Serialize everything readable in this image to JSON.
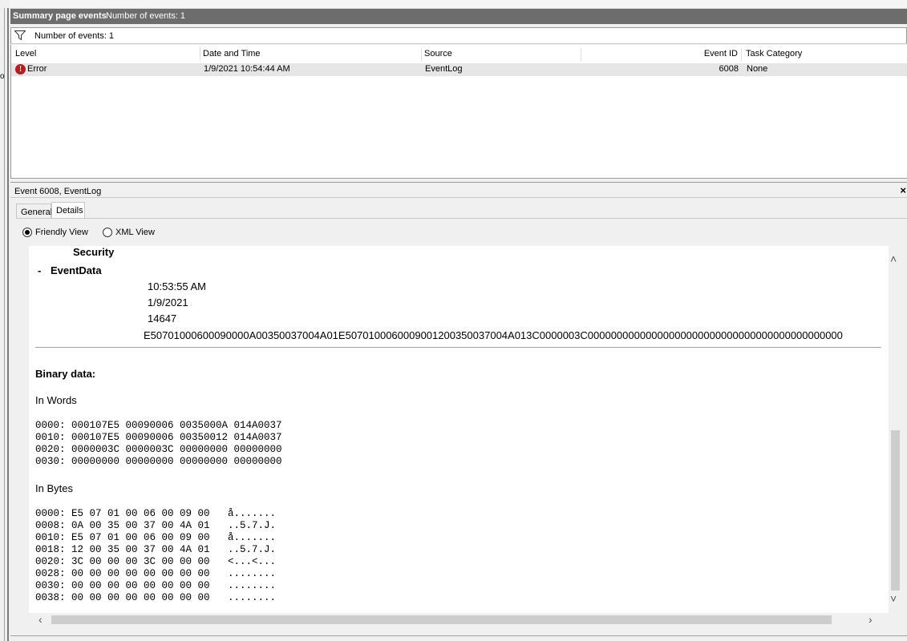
{
  "window": {
    "left_edge_char": "o"
  },
  "summary": {
    "title": "Summary page events",
    "count_label": "Number of events: 1"
  },
  "filter_bar": {
    "text": "Number of events: 1",
    "icon": "funnel-icon"
  },
  "events_table": {
    "columns": [
      "Level",
      "Date and Time",
      "Source",
      "Event ID",
      "Task Category"
    ],
    "rows": [
      {
        "level": "Error",
        "level_icon": "error-icon",
        "date_time": "1/9/2021 10:54:44 AM",
        "source": "EventLog",
        "event_id": "6008",
        "task_category": "None"
      }
    ]
  },
  "detail_pane": {
    "title": "Event 6008, EventLog",
    "close_glyph": "×",
    "tabs": [
      {
        "label": "General",
        "active": false
      },
      {
        "label": "Details",
        "active": true
      }
    ],
    "view_options": [
      {
        "label": "Friendly View",
        "selected": true
      },
      {
        "label": "XML View",
        "selected": false
      }
    ]
  },
  "details": {
    "security_label": "Security",
    "eventdata_toggle": "-",
    "eventdata_label": "EventData",
    "data_values": [
      "10:53:55 AM",
      "1/9/2021",
      "14647",
      "E50701000600090000A00350037004A01E5070100060009001200350037004A013C0000003C00000000000000000000000000000000000000000000"
    ],
    "binary_heading": "Binary data:",
    "in_words_label": "In Words",
    "words_lines": [
      "0000: 000107E5 00090006 0035000A 014A0037",
      "0010: 000107E5 00090006 00350012 014A0037",
      "0020: 0000003C 0000003C 00000000 00000000",
      "0030: 00000000 00000000 00000000 00000000"
    ],
    "in_bytes_label": "In Bytes",
    "bytes_lines": [
      "0000: E5 07 01 00 06 00 09 00   å.......",
      "0008: 0A 00 35 00 37 00 4A 01   ..5.7.J.",
      "0010: E5 07 01 00 06 00 09 00   å.......",
      "0018: 12 00 35 00 37 00 4A 01   ..5.7.J.",
      "0020: 3C 00 00 00 3C 00 00 00   <...<...",
      "0028: 00 00 00 00 00 00 00 00   ........",
      "0030: 00 00 00 00 00 00 00 00   ........",
      "0038: 00 00 00 00 00 00 00 00   ........"
    ]
  },
  "scrollbars": {
    "up": "˄",
    "down": "˅",
    "left": "‹",
    "right": "›"
  }
}
